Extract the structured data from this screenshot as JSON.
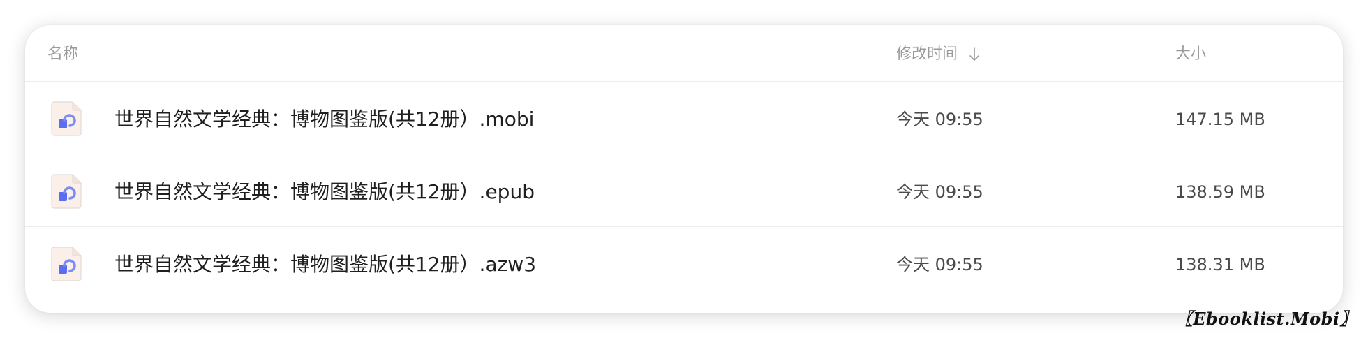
{
  "header": {
    "name_label": "名称",
    "modified_label": "修改时间",
    "sort_indicator": "arrow-down-icon",
    "size_label": "大小"
  },
  "files": [
    {
      "name": "世界自然文学经典：博物图鉴版(共12册）.mobi",
      "modified": "今天 09:55",
      "size": "147.15 MB",
      "icon": "ebook-file-icon"
    },
    {
      "name": "世界自然文学经典：博物图鉴版(共12册）.epub",
      "modified": "今天 09:55",
      "size": "138.59 MB",
      "icon": "ebook-file-icon"
    },
    {
      "name": "世界自然文学经典：博物图鉴版(共12册）.azw3",
      "modified": "今天 09:55",
      "size": "138.31 MB",
      "icon": "ebook-file-icon"
    }
  ],
  "watermark": "〖Ebooklist.Mobi〗",
  "colors": {
    "icon_accent": "#6b7df0",
    "icon_tint": "#fbefe9",
    "header_text": "#9a9a9a",
    "divider": "#ececec"
  }
}
